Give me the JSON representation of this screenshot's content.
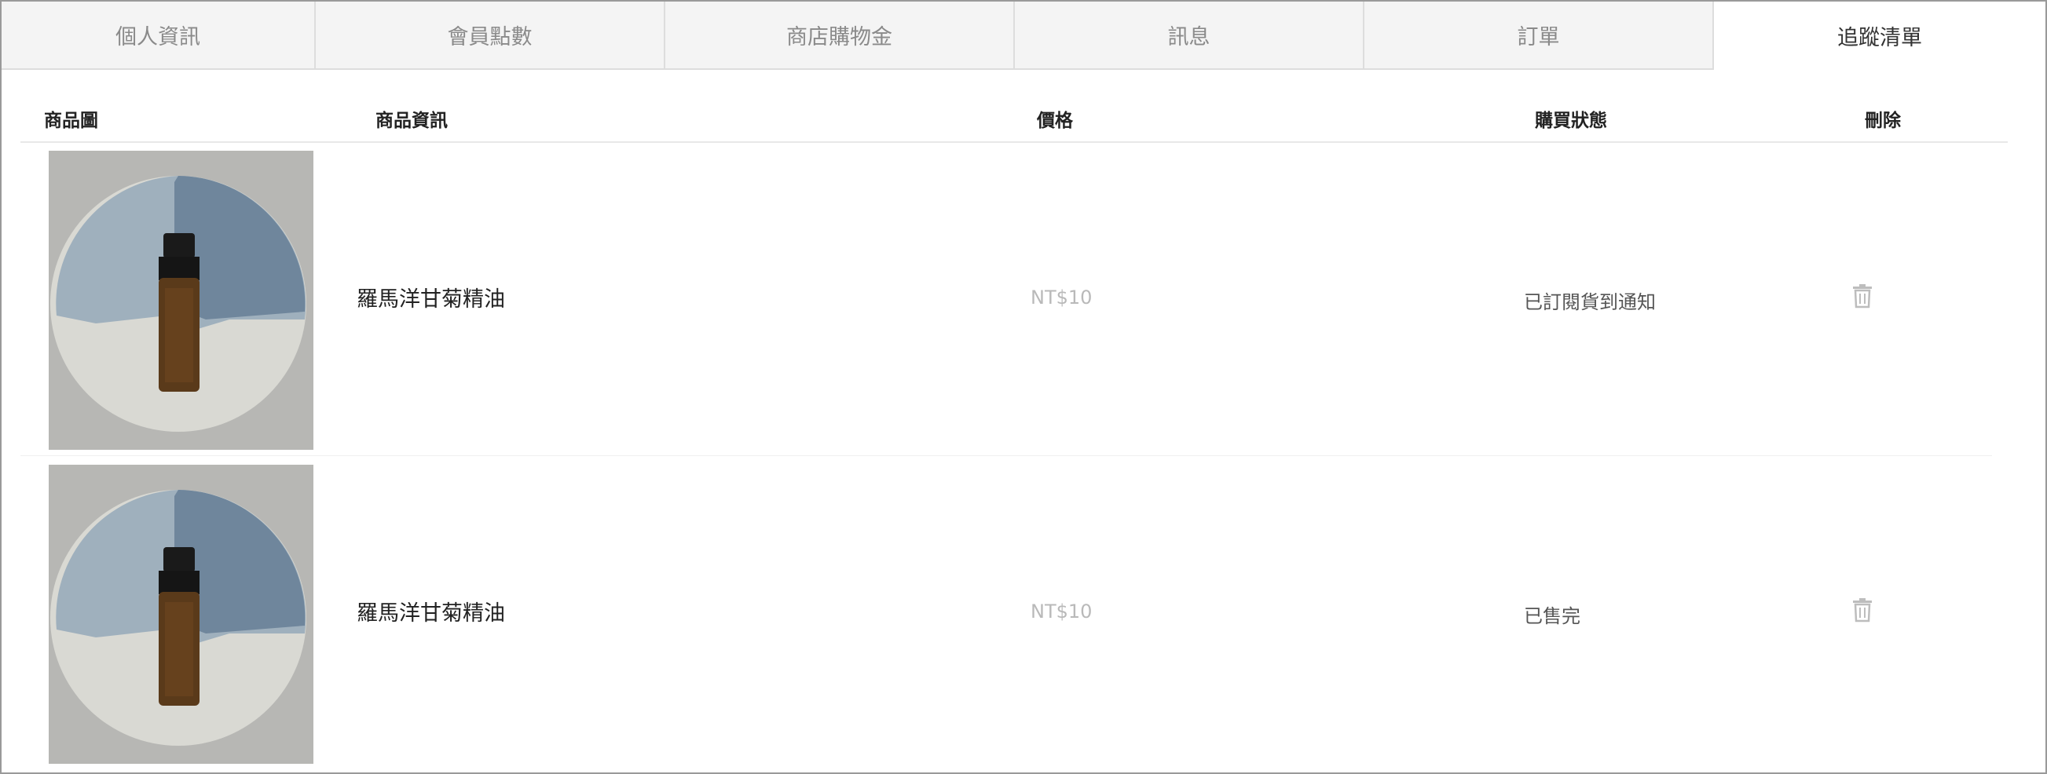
{
  "tabs": [
    {
      "label": "個人資訊"
    },
    {
      "label": "會員點數"
    },
    {
      "label": "商店購物金"
    },
    {
      "label": "訊息"
    },
    {
      "label": "訂單"
    },
    {
      "label": "追蹤清單"
    }
  ],
  "table": {
    "headers": {
      "image": "商品圖",
      "info": "商品資訊",
      "price": "價格",
      "status": "購買狀態",
      "delete": "刪除"
    },
    "rows": [
      {
        "name": "羅馬洋甘菊精油",
        "price": "NT$10",
        "status": "已訂閱貨到通知",
        "delete_icon": "trash-icon"
      },
      {
        "name": "羅馬洋甘菊精油",
        "price": "NT$10",
        "status": "已售完",
        "delete_icon": "trash-icon"
      }
    ]
  },
  "colors": {
    "tab_inactive_bg": "#f4f4f4",
    "tab_active_bg": "#ffffff",
    "price_text": "#b9b9b9"
  }
}
